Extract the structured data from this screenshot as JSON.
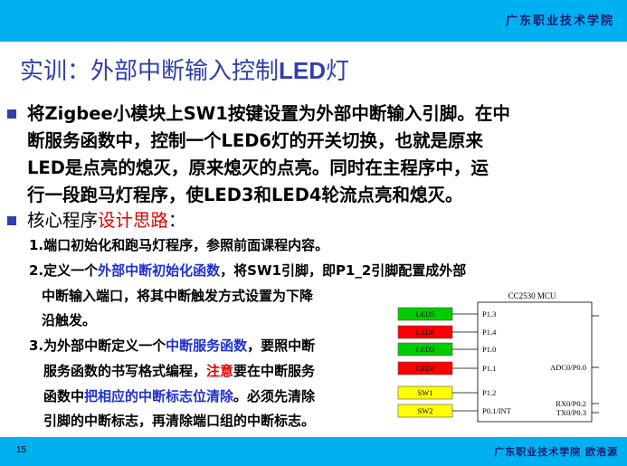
{
  "header": {
    "institution": "广东职业技术学院"
  },
  "title": {
    "prefix": "实训：外部中断输入控制",
    "suffix_latin": "LED",
    "suffix": "灯"
  },
  "intro": {
    "lines": [
      "将Zigbee小模块上SW1按键设置为外部中断输入引脚。在中",
      "断服务函数中，控制一个LED6灯的开关切换，也就是原来",
      "LED是点亮的熄灭，原来熄灭的点亮。同时在主程序中，运",
      "行一段跑马灯程序，使LED3和LED4轮流点亮和熄灭。"
    ]
  },
  "core": {
    "label": "核心程序",
    "highlight": "设计思路",
    "colon": "："
  },
  "steps": {
    "s1": "1.端口初始化和跑马灯程序，参照前面课程内容。",
    "s2_a": "2.定义一个",
    "s2_b": "外部中断初始化函数",
    "s2_c": "，将SW1引脚，即P1_2引脚配置成外部",
    "s2_l2": "中断输入端口，将其中断触发方式设置为下降",
    "s2_l3": "沿触发。",
    "s3_a": "3.为外部中断定义一个",
    "s3_b": "中断服务函数",
    "s3_c": "，要照中断",
    "s3_l2a": "服务函数的书写格式编程，",
    "s3_l2b": "注意",
    "s3_l2c": "要在中断服务",
    "s3_l3a": "函数中",
    "s3_l3b": "把相应的中断标志位清除",
    "s3_l3c": "。必须先清除",
    "s3_l4": "引脚的中断标志，再清除端口组的中断标志。"
  },
  "diagram": {
    "chip_label": "CC2530 MCU",
    "pins": [
      {
        "signal": "LED5",
        "pin": "P1.3",
        "color": "#00cc00"
      },
      {
        "signal": "LED6",
        "pin": "P1.4",
        "color": "#ff0000"
      },
      {
        "signal": "LED3",
        "pin": "P1.0",
        "color": "#00cc00"
      },
      {
        "signal": "LED4",
        "pin": "P1.1",
        "color": "#ff0000"
      },
      {
        "signal": "SW1",
        "pin": "P1.2",
        "color": "#ffff00"
      },
      {
        "signal": "SW2",
        "pin": "P0.1/INT",
        "color": "#ffff00"
      }
    ],
    "right_pins": [
      "ADC0/P0.0",
      "RX0/P0.2",
      "TX0/P0.3"
    ]
  },
  "footer": {
    "page": "15",
    "text": "广东职业技术学院  欧浩源"
  }
}
